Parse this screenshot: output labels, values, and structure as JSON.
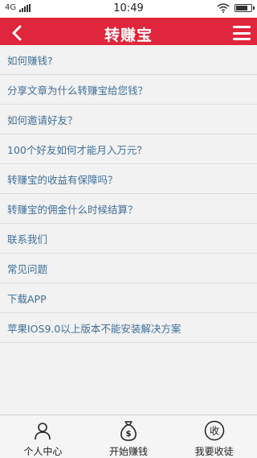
{
  "status_bar": {
    "network": "4G",
    "time": "10:49"
  },
  "header": {
    "title": "转赚宝",
    "back_icon": "chevron-left-icon",
    "menu_icon": "hamburger-menu-icon"
  },
  "faq": {
    "items": [
      {
        "label": "如何赚钱?"
      },
      {
        "label": "分享文章为什么转赚宝给您钱？"
      },
      {
        "label": "如何邀请好友？"
      },
      {
        "label": "100个好友如何才能月入万元？"
      },
      {
        "label": "转赚宝的收益有保障吗？"
      },
      {
        "label": "转赚宝的佣金什么时候结算？"
      },
      {
        "label": "联系我们"
      },
      {
        "label": "常见问题"
      },
      {
        "label": "下载APP"
      },
      {
        "label": "苹果IOS9.0以上版本不能安装解决方案"
      }
    ]
  },
  "tab_bar": {
    "tabs": [
      {
        "label": "个人中心",
        "icon": "person-icon"
      },
      {
        "label": "开始赚钱",
        "icon": "money-bag-icon"
      },
      {
        "label": "我要收徒",
        "icon": "shou-circle-icon",
        "icon_text": "收"
      }
    ]
  },
  "colors": {
    "header_bg": "#e0263c",
    "link_text": "#3f6f9a",
    "page_bg": "#f2f2f2"
  }
}
